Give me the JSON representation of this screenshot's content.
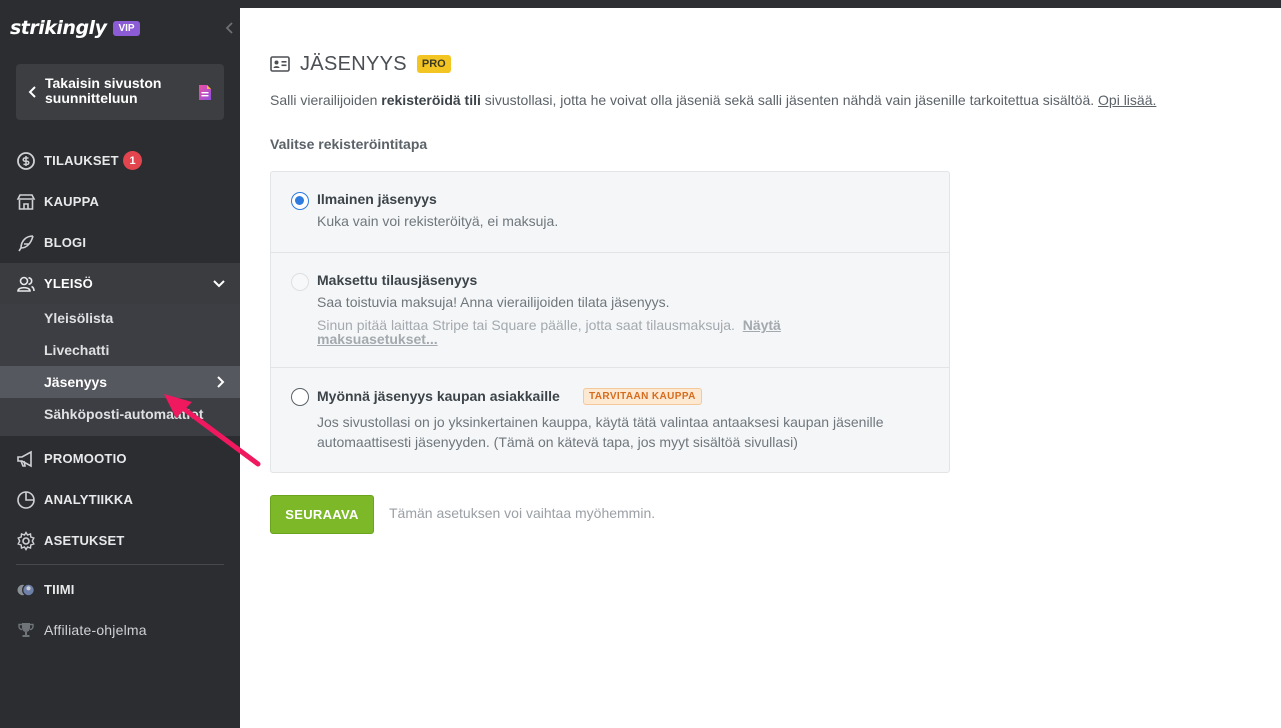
{
  "sidebar": {
    "logo": "strikingly",
    "vip": "VIP",
    "back_label": "Takaisin sivuston suunnitteluun",
    "nav": {
      "tilaukset": "TILAUKSET",
      "tilaukset_badge": "1",
      "kauppa": "KAUPPA",
      "blogi": "BLOGI",
      "yleiso": "YLEISÖ",
      "promootio": "PROMOOTIO",
      "analytiikka": "ANALYTIIKKA",
      "asetukset": "ASETUKSET",
      "tiimi": "TIIMI",
      "affiliate": "Affiliate-ohjelma"
    },
    "sub": {
      "yleisolista": "Yleisölista",
      "livechatti": "Livechatti",
      "jasenyys": "Jäsenyys",
      "sahkoposti": "Sähköposti-automaatiot"
    }
  },
  "main": {
    "title": "JÄSENYYS",
    "pro": "PRO",
    "desc_pre": "Salli vierailijoiden ",
    "desc_bold": "rekisteröidä tili",
    "desc_post": " sivustollasi, jotta he voivat olla jäseniä sekä salli jäsenten nähdä vain jäsenille tarkoitettua sisältöä. ",
    "desc_link": "Opi lisää.",
    "section_label": "Valitse rekisteröintitapa",
    "options": [
      {
        "title": "Ilmainen jäsenyys",
        "sub": "Kuka vain voi rekisteröityä, ei maksuja.",
        "state": "checked"
      },
      {
        "title": "Maksettu tilausjäsenyys",
        "sub": "Saa toistuvia maksuja! Anna vierailijoiden tilata jäsenyys.",
        "note": "Sinun pitää laittaa Stripe tai Square päälle, jotta saat tilausmaksuja.",
        "note_link": "Näytä maksuasetukset...",
        "state": "disabled"
      },
      {
        "title": "Myönnä jäsenyys kaupan asiakkaille",
        "tag": "TARVITAAN KAUPPA",
        "sub1": "Jos sivustollasi on jo yksinkertainen kauppa, käytä tätä valintaa antaaksesi kaupan jäsenille",
        "sub2": "automaattisesti jäsenyyden. (Tämä on kätevä tapa, jos myyt sisältöä sivullasi)",
        "state": "unchecked"
      }
    ],
    "next_label": "SEURAAVA",
    "hint": "Tämän asetuksen voi vaihtaa myöhemmin."
  },
  "colors": {
    "sidebar": "#2b2d30",
    "accent_green": "#7db828",
    "radio_blue": "#2e7ce0",
    "pro_yellow": "#f3c522",
    "badge_red": "#e2454e",
    "vip_purple": "#8b5cd6",
    "arrow_pink": "#f0185f"
  },
  "icons": [
    "dollar-circle-icon",
    "store-icon",
    "feather-icon",
    "people-icon",
    "megaphone-icon",
    "pie-chart-icon",
    "gear-icon",
    "team-avatar-icon",
    "trophy-icon",
    "id-card-icon",
    "chevron-left-icon",
    "chevron-down-icon",
    "chevron-right-icon",
    "document-icon"
  ]
}
